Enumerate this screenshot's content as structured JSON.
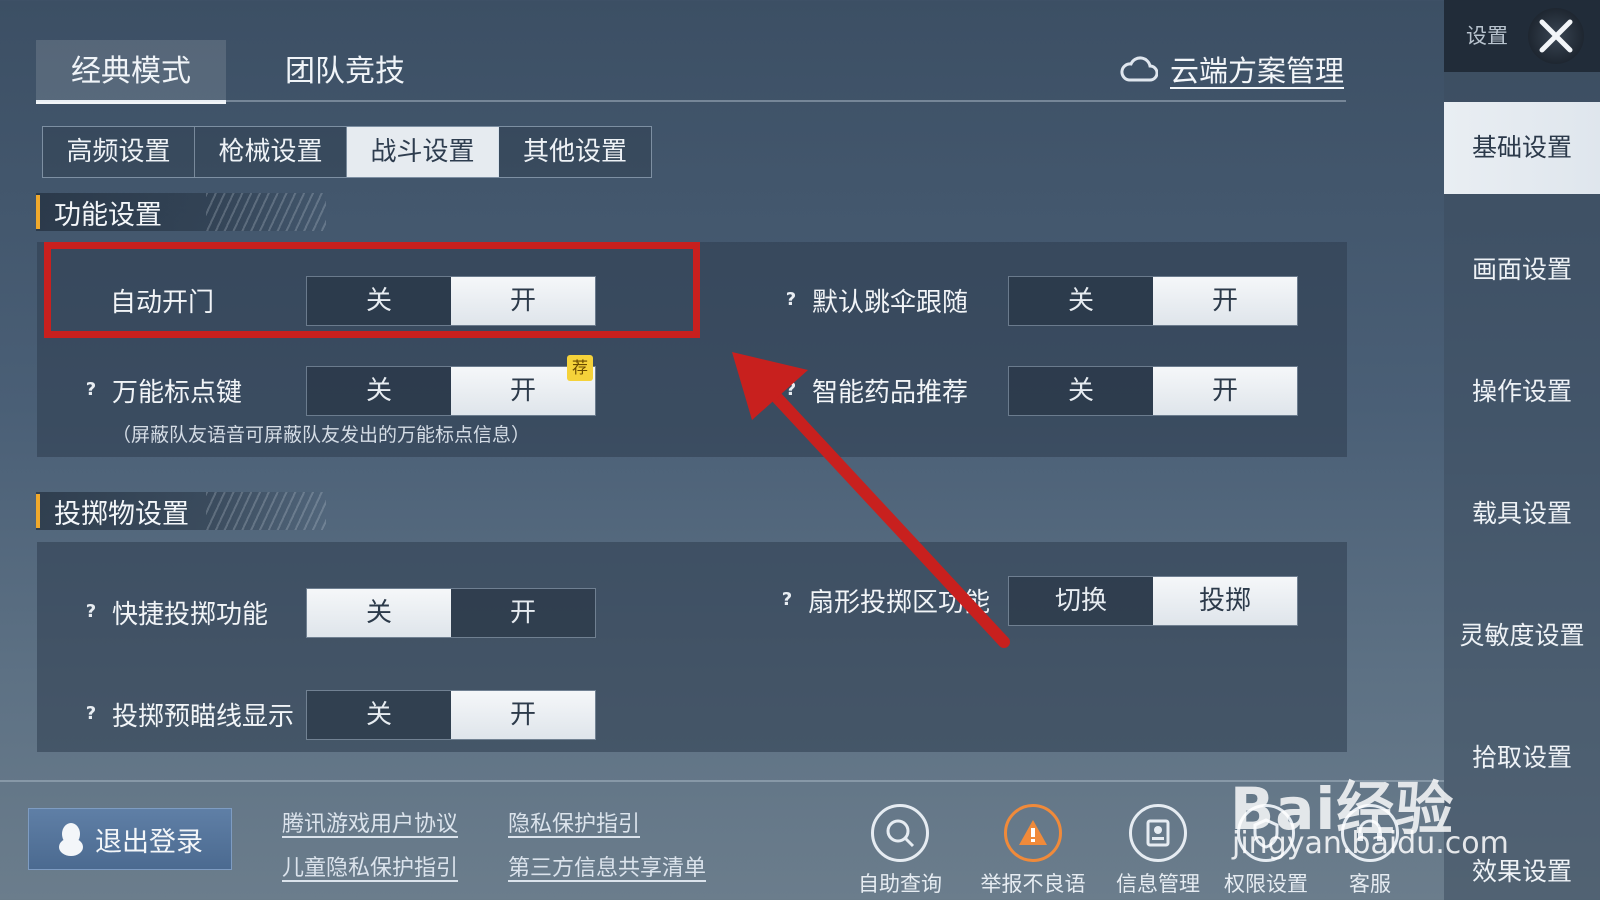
{
  "mode_tabs": [
    {
      "label": "经典模式",
      "active": true
    },
    {
      "label": "团队竞技",
      "active": false
    }
  ],
  "cloud_link": {
    "label": "云端方案管理",
    "icon": "cloud-icon"
  },
  "sub_tabs": [
    {
      "label": "高频设置",
      "active": false
    },
    {
      "label": "枪械设置",
      "active": false
    },
    {
      "label": "战斗设置",
      "active": true
    },
    {
      "label": "其他设置",
      "active": false
    }
  ],
  "sections": {
    "function": {
      "title": "功能设置",
      "auto_door": {
        "label": "自动开门",
        "off": "关",
        "on": "开",
        "value": "开"
      },
      "marker_key": {
        "label": "万能标点键",
        "off": "关",
        "on": "开",
        "value": "开",
        "badge": "荐",
        "hint": "（屏蔽队友语音可屏蔽队友发出的万能标点信息）"
      },
      "parachute_follow": {
        "label": "默认跳伞跟随",
        "off": "关",
        "on": "开",
        "value": "开"
      },
      "medicine_recommend": {
        "label": "智能药品推荐",
        "off": "关",
        "on": "开",
        "value": "开"
      }
    },
    "throwable": {
      "title": "投掷物设置",
      "quick_throw": {
        "label": "快捷投掷功能",
        "off": "关",
        "on": "开",
        "value": "关"
      },
      "aim_line": {
        "label": "投掷预瞄线显示",
        "off": "关",
        "on": "开",
        "value": "开"
      },
      "fan_zone": {
        "label": "扇形投掷区功能",
        "off": "切换",
        "on": "投掷",
        "value": "投掷"
      }
    }
  },
  "sidebar": {
    "title": "设置",
    "items": [
      {
        "label": "基础设置",
        "active": true
      },
      {
        "label": "画面设置",
        "active": false
      },
      {
        "label": "操作设置",
        "active": false
      },
      {
        "label": "载具设置",
        "active": false
      },
      {
        "label": "灵敏度设置",
        "active": false
      },
      {
        "label": "拾取设置",
        "active": false
      },
      {
        "label": "效果设置",
        "active": false
      }
    ]
  },
  "bottom": {
    "logout": "退出登录",
    "links": [
      "腾讯游戏用户协议",
      "隐私保护指引",
      "儿童隐私保护指引",
      "第三方信息共享清单"
    ],
    "icons": [
      {
        "label": "自助查询",
        "icon": "search-icon"
      },
      {
        "label": "举报不良语音",
        "icon": "report-voice-icon"
      },
      {
        "label": "信息管理",
        "icon": "profile-icon"
      },
      {
        "label": "权限设置",
        "icon": "permission-icon"
      },
      {
        "label": "客服",
        "icon": "support-icon"
      }
    ]
  },
  "watermark": {
    "text": "Bai经验",
    "url": "jingyan.baidu.com"
  },
  "colors": {
    "highlight_box": "#c8201e",
    "arrow": "#c8201e",
    "section_accent": "#f0a92c",
    "recommend_badge": "#f5d23a"
  }
}
